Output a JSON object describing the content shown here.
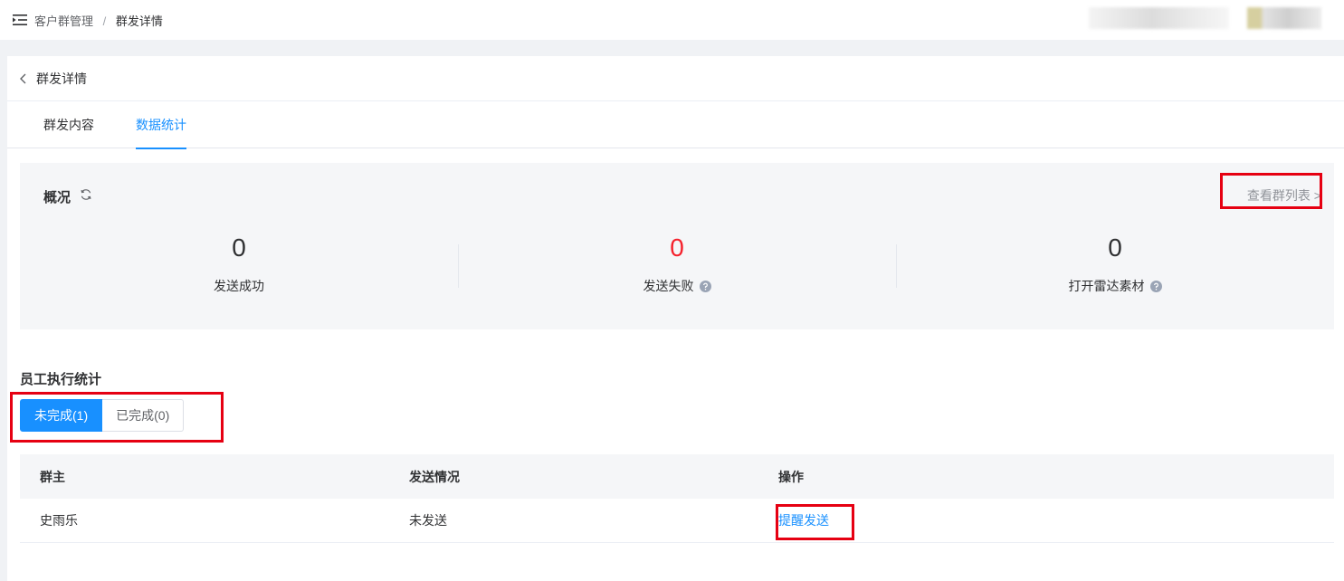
{
  "header": {
    "breadcrumb_parent": "客户群管理",
    "breadcrumb_separator": "/",
    "breadcrumb_current": "群发详情"
  },
  "page": {
    "title": "群发详情"
  },
  "tabs": [
    {
      "label": "群发内容",
      "active": false
    },
    {
      "label": "数据统计",
      "active": true
    }
  ],
  "overview": {
    "title": "概况",
    "view_list_label": "查看群列表 >",
    "stats": [
      {
        "value": "0",
        "label": "发送成功"
      },
      {
        "value": "0",
        "label": "发送失败"
      },
      {
        "value": "0",
        "label": "打开雷达素材"
      }
    ]
  },
  "employee": {
    "title": "员工执行统计",
    "segments": [
      {
        "label": "未完成(1)",
        "active": true
      },
      {
        "label": "已完成(0)",
        "active": false
      }
    ],
    "columns": [
      "群主",
      "发送情况",
      "操作"
    ],
    "rows": [
      {
        "owner": "史雨乐",
        "status": "未发送",
        "action": "提醒发送"
      }
    ]
  },
  "colors": {
    "accent": "#1890ff",
    "failure": "#f5222d",
    "highlight_box": "#e60012"
  },
  "icons": [
    "menu-fold-icon",
    "back-arrow-icon",
    "refresh-icon",
    "question-circle-icon",
    "chevron-right-icon"
  ]
}
